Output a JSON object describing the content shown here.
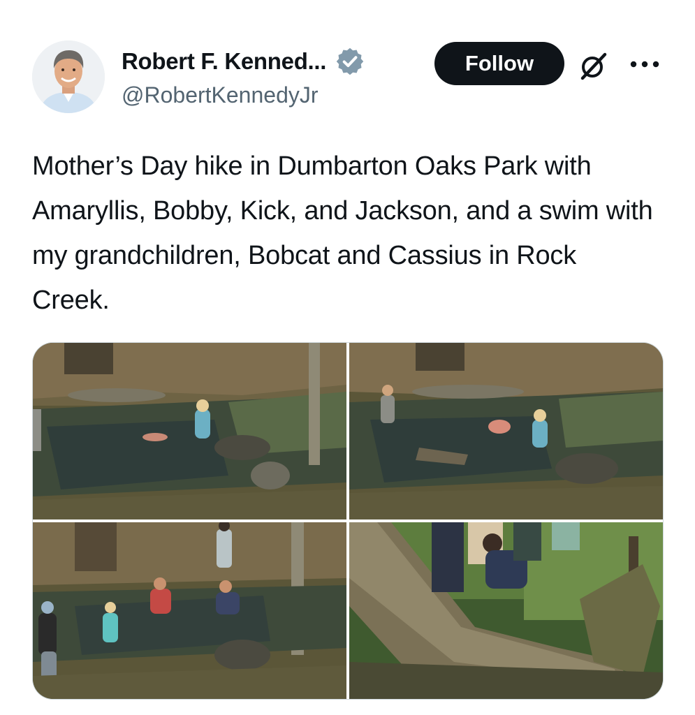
{
  "post": {
    "author": {
      "display_name": "Robert F. Kenned...",
      "handle": "@RobertKennedyJr",
      "verified": true,
      "verified_color": "#829aab"
    },
    "follow_label": "Follow",
    "text": "Mother’s Day hike in Dumbarton Oaks Park with Amaryllis, Bobby, Kick, and Jackson, and a swim with my grandchildren, Bobcat and Cassius in Rock Creek.",
    "icons": {
      "verified": "verified-badge-icon",
      "grok": "grok-icon",
      "more": "more-options-icon"
    },
    "media": {
      "count": 4
    }
  }
}
